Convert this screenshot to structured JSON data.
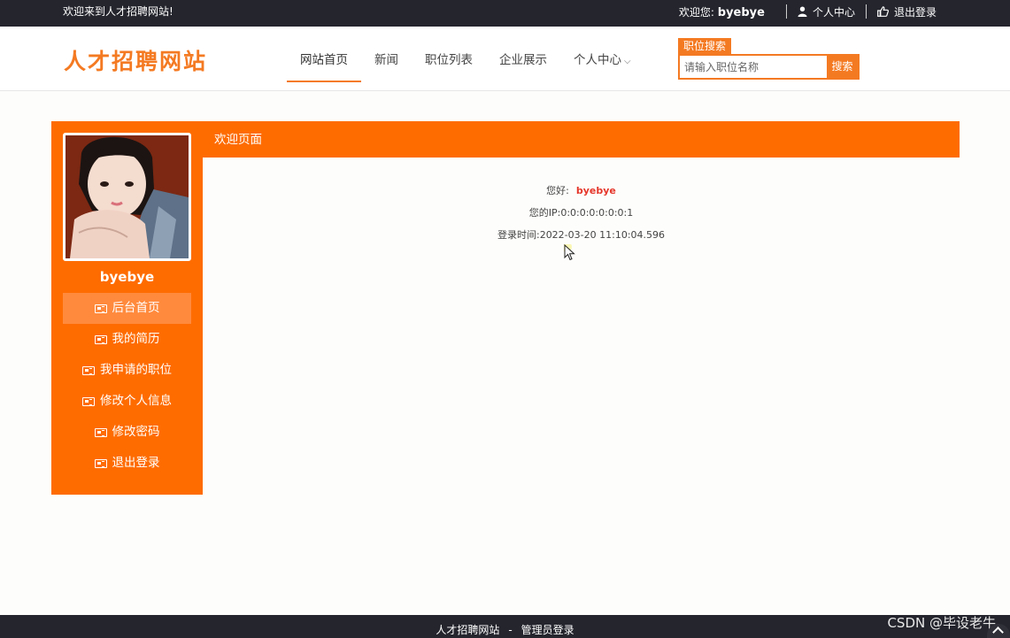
{
  "topbar": {
    "welcome": "欢迎来到人才招聘网站!",
    "greeting_prefix": "欢迎您:",
    "username": "byebye",
    "personal_center": "个人中心",
    "logout": "退出登录"
  },
  "header": {
    "logo": "人才招聘网站",
    "nav": [
      {
        "label": "网站首页",
        "active": true
      },
      {
        "label": "新闻"
      },
      {
        "label": "职位列表"
      },
      {
        "label": "企业展示"
      },
      {
        "label": "个人中心"
      }
    ],
    "search": {
      "tag": "职位搜索",
      "placeholder": "请输入职位名称",
      "button": "搜索"
    }
  },
  "sidebar": {
    "username": "byebye",
    "menu": [
      {
        "label": "后台首页",
        "active": true
      },
      {
        "label": "我的简历"
      },
      {
        "label": "我申请的职位"
      },
      {
        "label": "修改个人信息"
      },
      {
        "label": "修改密码"
      },
      {
        "label": "退出登录"
      }
    ]
  },
  "panel": {
    "title": "欢迎页面",
    "hello_label": "您好:",
    "hello_name": "byebye",
    "ip_line": "您的IP:0:0:0:0:0:0:0:1",
    "login_time_line": "登录时间:2022-03-20 11:10:04.596"
  },
  "footer": {
    "site": "人才招聘网站",
    "separator": "-",
    "admin_login": "管理员登录"
  },
  "watermark": "CSDN @毕设老牛",
  "colors": {
    "accent": "#fe6c00",
    "dark_bar": "#24252d",
    "highlight_red": "#e5372b"
  }
}
